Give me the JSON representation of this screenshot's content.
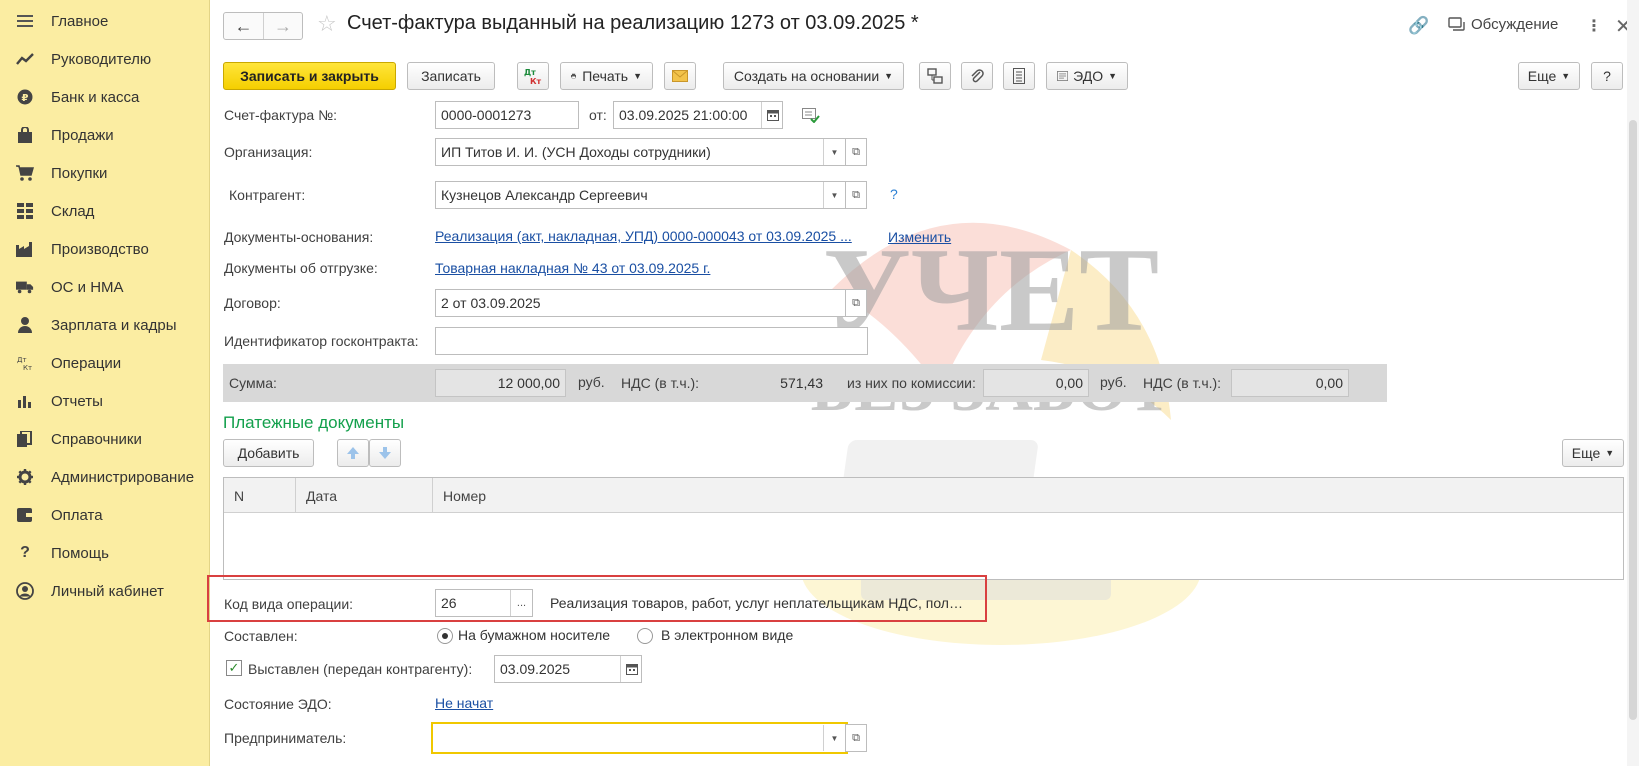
{
  "sidebar": {
    "items": [
      {
        "label": "Главное",
        "icon": "menu-icon"
      },
      {
        "label": "Руководителю",
        "icon": "trend-icon"
      },
      {
        "label": "Банк и касса",
        "icon": "ruble-coin-icon"
      },
      {
        "label": "Продажи",
        "icon": "shopping-bag-icon"
      },
      {
        "label": "Покупки",
        "icon": "cart-icon"
      },
      {
        "label": "Склад",
        "icon": "warehouse-grid-icon"
      },
      {
        "label": "Производство",
        "icon": "factory-icon"
      },
      {
        "label": "ОС и НМА",
        "icon": "truck-icon"
      },
      {
        "label": "Зарплата и кадры",
        "icon": "person-icon"
      },
      {
        "label": "Операции",
        "icon": "dt-kt-icon"
      },
      {
        "label": "Отчеты",
        "icon": "bar-chart-icon"
      },
      {
        "label": "Справочники",
        "icon": "books-icon"
      },
      {
        "label": "Администрирование",
        "icon": "gear-icon"
      },
      {
        "label": "Оплата",
        "icon": "wallet-icon"
      },
      {
        "label": "Помощь",
        "icon": "question-icon"
      },
      {
        "label": "Личный кабинет",
        "icon": "user-circle-icon"
      }
    ]
  },
  "header": {
    "title": "Счет-фактура выданный на реализацию 1273 от 03.09.2025 *",
    "discussion": "Обсуждение"
  },
  "toolbar": {
    "save_close": "Записать и закрыть",
    "save": "Записать",
    "dt_kt": "Дт Кт",
    "print": "Печать",
    "create_based": "Создать на основании",
    "edo": "ЭДО",
    "more": "Еще",
    "help": "?"
  },
  "form": {
    "invoice_label": "Счет-фактура №:",
    "invoice_number": "0000-0001273",
    "from_label": "от:",
    "invoice_date": "03.09.2025 21:00:00",
    "org_label": "Организация:",
    "org_value": "ИП Титов И. И. (УСН Доходы сотрудники)",
    "counterparty_label": "Контрагент:",
    "counterparty_value": "Кузнецов Александр Сергеевич",
    "base_docs_label": "Документы-основания:",
    "base_docs_link": "Реализация (акт, накладная, УПД) 0000-000043 от 03.09.2025 ...",
    "change_link": "Изменить",
    "shipment_docs_label": "Документы об отгрузке:",
    "shipment_docs_link": "Товарная накладная № 43 от 03.09.2025 г.",
    "contract_label": "Договор:",
    "contract_value": "2 от 03.09.2025",
    "gov_contract_label": "Идентификатор госконтракта:",
    "gov_contract_value": "",
    "question_mark": "?"
  },
  "sums": {
    "sum_label": "Сумма:",
    "sum_value": "12 000,00",
    "currency1": "руб.",
    "vat_label1": "НДС (в т.ч.):",
    "vat_value1": "571,43",
    "commission_label": "из них по комиссии:",
    "commission_value": "0,00",
    "currency2": "руб.",
    "vat_label2": "НДС (в т.ч.):",
    "vat_value2": "0,00"
  },
  "payments": {
    "title": "Платежные документы",
    "add_button": "Добавить",
    "more": "Еще",
    "columns": [
      "N",
      "Дата",
      "Номер"
    ]
  },
  "operation": {
    "code_label": "Код вида операции:",
    "code_value": "26",
    "code_description": "Реализация товаров, работ, услуг неплательщикам НДС, пол…",
    "ellipsis": "..."
  },
  "compiled": {
    "label": "Составлен:",
    "paper": "На бумажном носителе",
    "electronic": "В электронном виде",
    "selected": "paper"
  },
  "issued": {
    "label": "Выставлен (передан контрагенту):",
    "checked": true,
    "date": "03.09.2025"
  },
  "edo_state": {
    "label": "Состояние ЭДО:",
    "value": "Не начат"
  },
  "entrepreneur": {
    "label": "Предприниматель:",
    "value": ""
  },
  "watermark": {
    "line1": "УЧЕТ",
    "line2": "БЕЗ ЗАБОТ"
  },
  "colors": {
    "sidebar_bg": "#fbeda2",
    "primary_button": "#f5cf00",
    "link": "#1a4fa3",
    "section_title": "#13a04c",
    "highlight_border": "#d94040",
    "focus_border": "#f0c800"
  }
}
